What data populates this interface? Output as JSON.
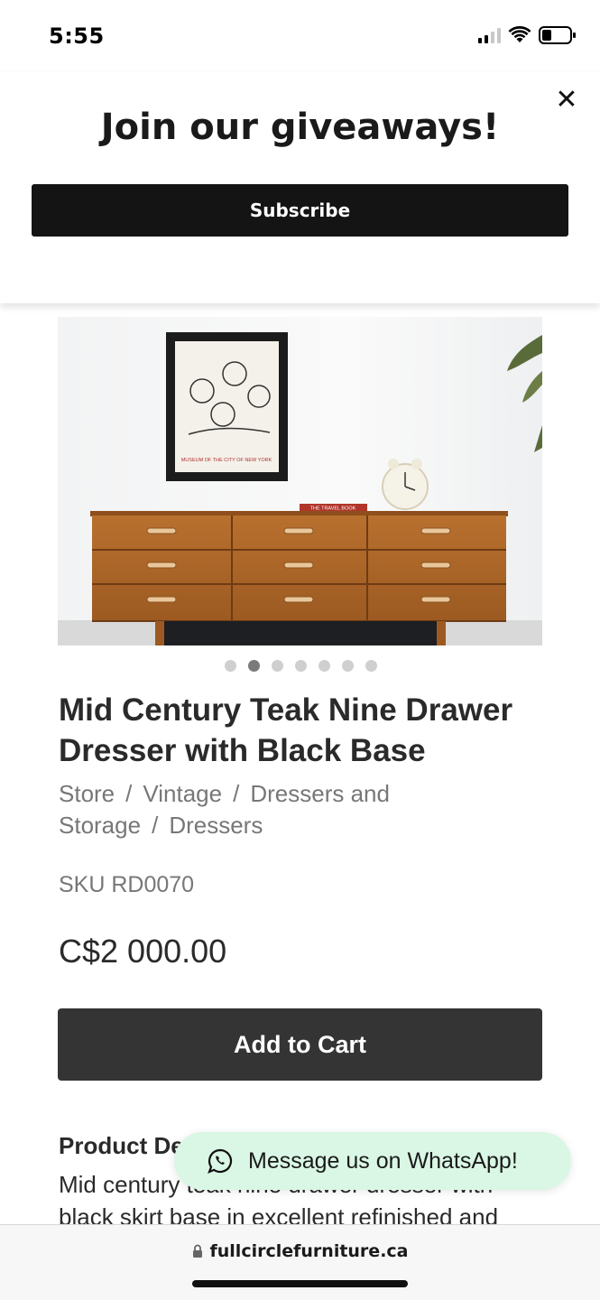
{
  "status_bar": {
    "time": "5:55",
    "icons": [
      "signal-icon",
      "wifi-icon",
      "battery-icon"
    ]
  },
  "popup": {
    "title": "Join our giveaways!",
    "subscribe_label": "Subscribe",
    "close_icon": "close-icon"
  },
  "product": {
    "image_poster_caption": "MUSEUM OF THE CITY OF NEW YORK",
    "image_book_caption": "THE TRAVEL BOOK",
    "carousel": {
      "count": 7,
      "active_index": 1
    },
    "title": "Mid Century Teak Nine Drawer Dresser with Black Base",
    "breadcrumb": [
      "Store",
      "Vintage",
      "Dressers and Storage",
      "Dressers"
    ],
    "breadcrumb_separator": "/",
    "sku": "SKU RD0070",
    "price": "C$2 000.00",
    "add_to_cart_label": "Add to Cart",
    "description_heading": "Product De",
    "description_text": "Mid century teak nine drawer dresser with black skirt base in excellent refinished and"
  },
  "whatsapp": {
    "label": "Message us on WhatsApp!",
    "icon": "whatsapp-icon",
    "bg_color": "#d9f7e4"
  },
  "browser": {
    "url": "fullcirclefurniture.ca",
    "lock_icon": "lock-icon"
  },
  "colors": {
    "button_dark": "#343434",
    "popup_button": "#141414",
    "muted_text": "#777777"
  }
}
